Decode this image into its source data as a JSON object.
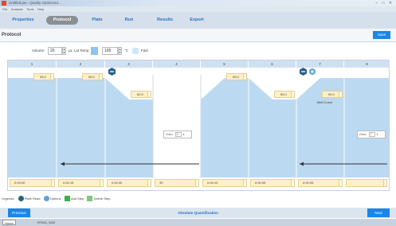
{
  "window": {
    "title": "Untitled.pw - Quality Optimized...",
    "controls": "– □ ✕"
  },
  "menu": [
    "File",
    "Analysis",
    "Tools",
    "Help"
  ],
  "tabs": [
    {
      "label": "Properties"
    },
    {
      "label": "Protocol"
    },
    {
      "label": "Plate"
    },
    {
      "label": "Run"
    },
    {
      "label": "Results"
    },
    {
      "label": "Export"
    }
  ],
  "header": {
    "title": "Protocol",
    "save_label": "Save"
  },
  "options": {
    "volume_label": "Volume:",
    "volume_value": "20",
    "volume_unit": "μL",
    "lid_label": "Lid Temp:",
    "lid_value": "105",
    "lid_unit": "°C",
    "fast_label": "Fast"
  },
  "steps": [
    {
      "num": "1",
      "temp": "95.0",
      "time": "0:03:00"
    },
    {
      "num": "2",
      "temp": "95.0",
      "time": "0:00:15"
    },
    {
      "num": "3",
      "temp": "60.0",
      "time": "0:00:30"
    },
    {
      "num": "4",
      "temp": "",
      "time": "39",
      "goto_label": "Goto",
      "goto_value": "2"
    },
    {
      "num": "5",
      "temp": "95.0",
      "time": "0:00:10"
    },
    {
      "num": "6",
      "temp": "65.0",
      "time": "0:00:05"
    },
    {
      "num": "7",
      "temp": "95.0",
      "time": "0:00:05",
      "note": "Melt Curve"
    },
    {
      "num": "8",
      "temp": "",
      "time": "",
      "goto_label": "Goto",
      "goto_value": "7"
    }
  ],
  "legend": {
    "label": "Legends:",
    "items": [
      {
        "label": "Plate Read",
        "icon": "plate-read-icon"
      },
      {
        "label": "Options",
        "icon": "options-gear-icon"
      },
      {
        "label": "Add Step",
        "icon": "add-step-icon"
      },
      {
        "label": "Delete Step",
        "icon": "delete-step-icon"
      }
    ]
  },
  "footer": {
    "previous_label": "Previous",
    "mode_label": "Absolute Quantification",
    "next_label": "Next"
  },
  "taskbar": {
    "item1": "Home",
    "item2": "RT001_SG2"
  }
}
